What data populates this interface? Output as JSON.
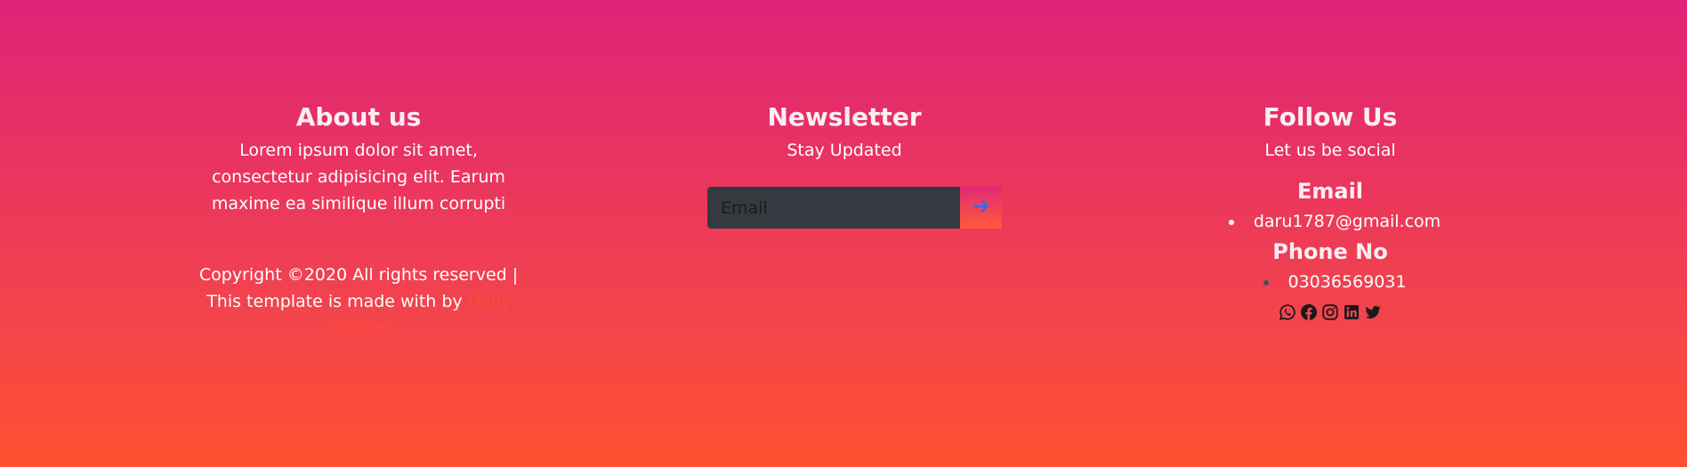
{
  "about": {
    "heading": "About us",
    "text": "Lorem ipsum dolor sit amet, consectetur adipisicing elit. Earum maxime ea similique illum corrupti",
    "copyright_line1": "Copyright ©2020 All rights reserved |",
    "copyright_line2_prefix": "This template is made with by ",
    "link_text": "Daily Tuition"
  },
  "newsletter": {
    "heading": "Newsletter",
    "subheading": "Stay Updated",
    "email_placeholder": "Email",
    "email_value": ""
  },
  "follow": {
    "heading": "Follow Us",
    "subheading": "Let us be social",
    "email_heading": "Email",
    "email_value": "daru1787@gmail.com",
    "phone_heading": "Phone No",
    "phone_value": "03036569031",
    "icons": [
      "whatsapp-icon",
      "facebook-icon",
      "instagram-icon",
      "linkedin-icon",
      "twitter-icon"
    ]
  },
  "colors": {
    "gradient_top": "#de2377",
    "gradient_bottom": "#ff5030",
    "input_bg": "#343a40",
    "link": "#ff4a33",
    "arrow": "#2d6cf2",
    "icon": "#1a1a1a"
  }
}
